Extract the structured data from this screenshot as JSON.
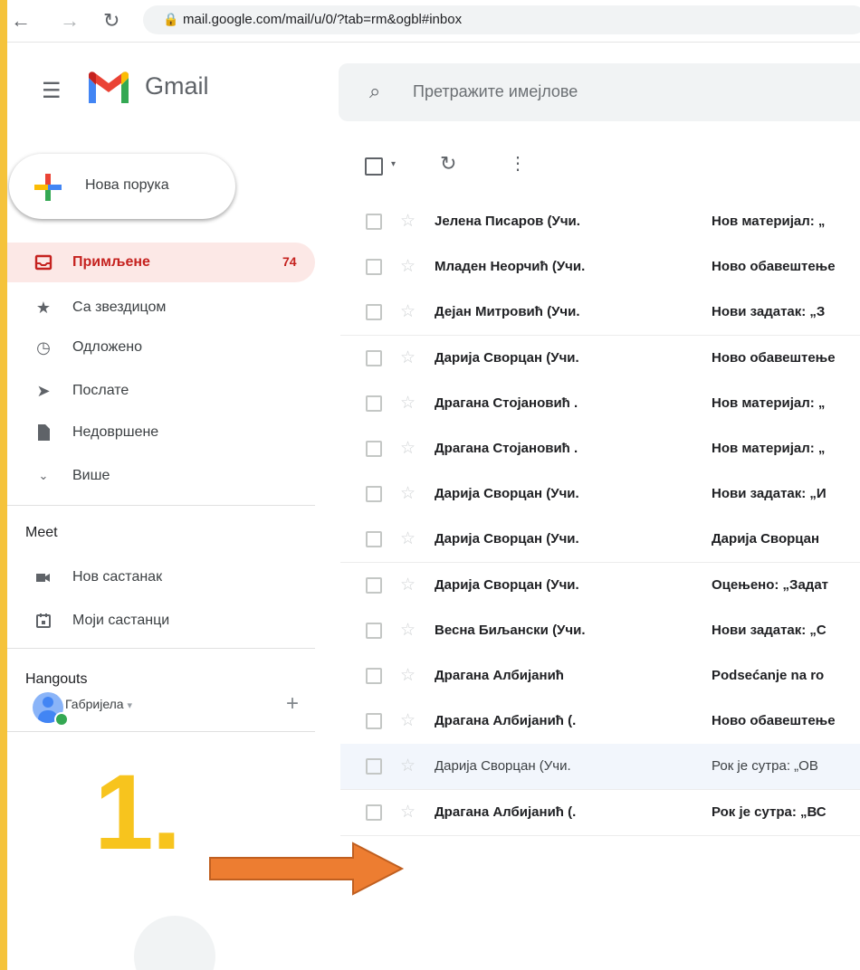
{
  "browser": {
    "url": "mail.google.com/mail/u/0/?tab=rm&ogbl#inbox"
  },
  "header": {
    "brand": "Gmail",
    "search_placeholder": "Претражите имејлове"
  },
  "compose": {
    "label": "Нова порука"
  },
  "sidebar": {
    "items": [
      {
        "label": "Примљене",
        "count": "74",
        "icon": "inbox-icon",
        "active": true
      },
      {
        "label": "Са звездицом",
        "icon": "star-icon"
      },
      {
        "label": "Одложено",
        "icon": "clock-icon"
      },
      {
        "label": "Послате",
        "icon": "send-icon"
      },
      {
        "label": "Недовршене",
        "icon": "draft-icon"
      },
      {
        "label": "Више",
        "icon": "chevron-down-icon"
      }
    ],
    "meet": {
      "title": "Meet",
      "items": [
        {
          "label": "Нов састанак",
          "icon": "video-icon"
        },
        {
          "label": "Моји састанци",
          "icon": "calendar-icon"
        }
      ]
    },
    "hangouts": {
      "title": "Hangouts",
      "user": "Габријела"
    }
  },
  "emails": [
    {
      "sender": "Јелена Писаров (Учи.",
      "subject": "Нов материјал: „"
    },
    {
      "sender": "Младен Неорчић (Учи.",
      "subject": "Ново обавештење"
    },
    {
      "sender": "Дејан Митровић (Учи.",
      "subject": "Нови задатак: „З"
    },
    {
      "sender": "Дарија Сворцан (Учи.",
      "subject": "Ново обавештење"
    },
    {
      "sender": "Драгана Стојановић .",
      "subject": "Нов материјал: „"
    },
    {
      "sender": "Драгана Стојановић .",
      "subject": "Нов материјал: „"
    },
    {
      "sender": "Дарија Сворцан (Учи.",
      "subject": "Нови задатак: „И"
    },
    {
      "sender": "Дарија Сворцан (Учи.",
      "subject": "Дарија Сворцан"
    },
    {
      "sender": "Дарија Сворцан (Учи.",
      "subject": "Оцењено: „Задат"
    },
    {
      "sender": "Весна Биљански (Учи.",
      "subject": "Нови задатак: „С"
    },
    {
      "sender": "Драгана Албијанић",
      "subject": "Podsećanje na ro"
    },
    {
      "sender": "Драгана Албијанић (.",
      "subject": "Ново обавештење"
    },
    {
      "sender": "Дарија Сворцан (Учи.",
      "subject": "Рок је сутра: „ОВ",
      "read": true
    },
    {
      "sender": "Драгана Албијанић (.",
      "subject": "Рок је сутра: „ВС"
    }
  ],
  "annotation": {
    "number": "1."
  },
  "colors": {
    "frame": "#f5c33b",
    "annotation": "#f7c41e",
    "arrow": "#ed7d31",
    "active": "#c5221f"
  }
}
